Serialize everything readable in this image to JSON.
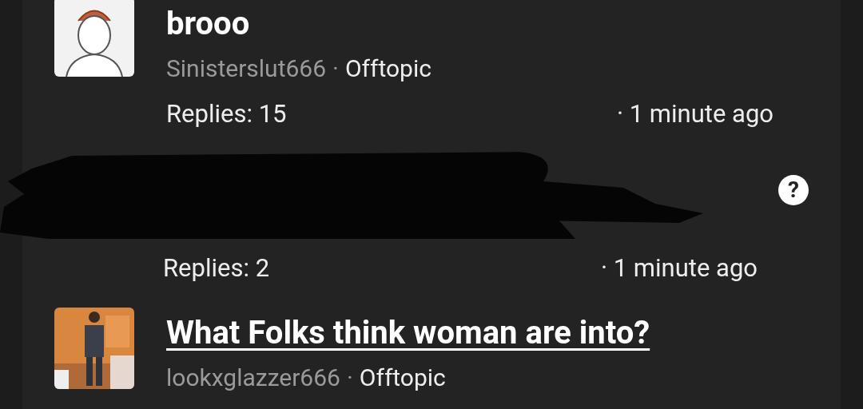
{
  "threads": [
    {
      "kind": "visible",
      "title": "brooo",
      "underlined": false,
      "author": "Sinisterslut666",
      "separator": "·",
      "category": "Offtopic",
      "replies": "Replies: 15",
      "time": "· 1 minute ago",
      "avatar": {
        "kind": "sketch"
      }
    },
    {
      "kind": "redacted",
      "replies": "Replies: 2",
      "time": "· 1 minute ago",
      "help": "?"
    },
    {
      "kind": "visible",
      "title": "What Folks think woman are into?",
      "underlined": true,
      "author": "lookxglazzer666",
      "separator": "·",
      "category": "Offtopic"
    }
  ]
}
